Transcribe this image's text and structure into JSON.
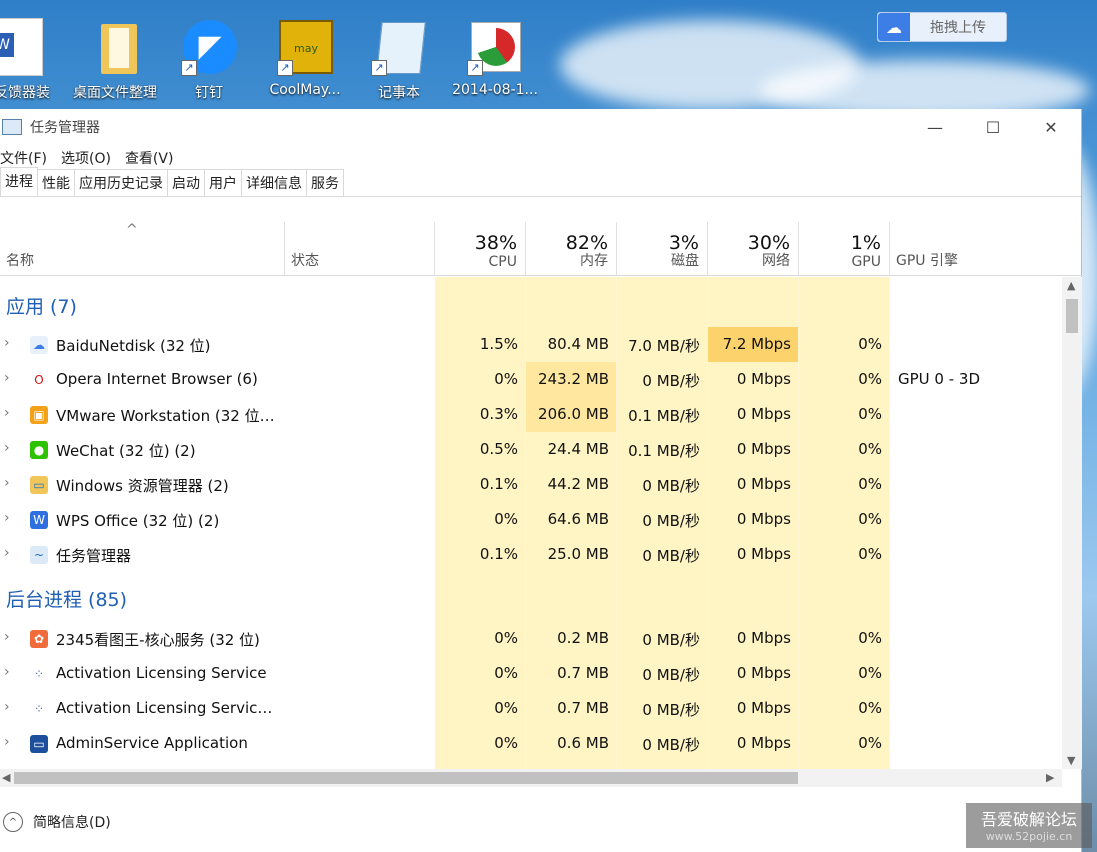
{
  "desktop": {
    "icons": [
      {
        "label": "边反馈器装",
        "icon": "word-doc-icon"
      },
      {
        "label": "桌面文件整理",
        "icon": "folder-icon"
      },
      {
        "label": "钉钉",
        "icon": "dingtalk-icon"
      },
      {
        "label": "CoolMay...",
        "icon": "coolmay-icon"
      },
      {
        "label": "记事本",
        "icon": "notepad-icon"
      },
      {
        "label": "2014-08-1...",
        "icon": "chart-file-icon"
      }
    ],
    "upload_button": "拖拽上传",
    "watermark": {
      "title": "吾爱破解论坛",
      "url": "www.52pojie.cn"
    }
  },
  "window": {
    "title": "任务管理器",
    "controls": {
      "minimize": "—",
      "maximize": "☐",
      "close": "✕"
    },
    "menu": [
      "文件(F)",
      "选项(O)",
      "查看(V)"
    ],
    "tabs": [
      "进程",
      "性能",
      "应用历史记录",
      "启动",
      "用户",
      "详细信息",
      "服务"
    ],
    "active_tab": "进程",
    "columns": {
      "name": "名称",
      "status": "状态",
      "cpu": {
        "pct": "38%",
        "label": "CPU"
      },
      "memory": {
        "pct": "82%",
        "label": "内存"
      },
      "disk": {
        "pct": "3%",
        "label": "磁盘"
      },
      "network": {
        "pct": "30%",
        "label": "网络"
      },
      "gpu": {
        "pct": "1%",
        "label": "GPU"
      },
      "gpu_engine": "GPU 引擎"
    },
    "sections": {
      "apps": "应用 (7)",
      "background": "后台进程 (85)"
    },
    "apps": [
      {
        "name": "BaiduNetdisk (32 位)",
        "cpu": "1.5%",
        "mem": "80.4 MB",
        "disk": "7.0 MB/秒",
        "net": "7.2 Mbps",
        "gpu": "0%",
        "gpu_engine": "",
        "icon": "baidunetdisk-icon"
      },
      {
        "name": "Opera Internet Browser (6)",
        "cpu": "0%",
        "mem": "243.2 MB",
        "disk": "0 MB/秒",
        "net": "0 Mbps",
        "gpu": "0%",
        "gpu_engine": "GPU 0 - 3D",
        "icon": "opera-icon"
      },
      {
        "name": "VMware Workstation (32 位) ...",
        "cpu": "0.3%",
        "mem": "206.0 MB",
        "disk": "0.1 MB/秒",
        "net": "0 Mbps",
        "gpu": "0%",
        "gpu_engine": "",
        "icon": "vmware-icon"
      },
      {
        "name": "WeChat (32 位) (2)",
        "cpu": "0.5%",
        "mem": "24.4 MB",
        "disk": "0.1 MB/秒",
        "net": "0 Mbps",
        "gpu": "0%",
        "gpu_engine": "",
        "icon": "wechat-icon"
      },
      {
        "name": "Windows 资源管理器 (2)",
        "cpu": "0.1%",
        "mem": "44.2 MB",
        "disk": "0 MB/秒",
        "net": "0 Mbps",
        "gpu": "0%",
        "gpu_engine": "",
        "icon": "explorer-icon"
      },
      {
        "name": "WPS Office (32 位) (2)",
        "cpu": "0%",
        "mem": "64.6 MB",
        "disk": "0 MB/秒",
        "net": "0 Mbps",
        "gpu": "0%",
        "gpu_engine": "",
        "icon": "wps-icon"
      },
      {
        "name": "任务管理器",
        "cpu": "0.1%",
        "mem": "25.0 MB",
        "disk": "0 MB/秒",
        "net": "0 Mbps",
        "gpu": "0%",
        "gpu_engine": "",
        "icon": "task-manager-icon"
      }
    ],
    "background": [
      {
        "name": "2345看图王-核心服务 (32 位)",
        "cpu": "0%",
        "mem": "0.2 MB",
        "disk": "0 MB/秒",
        "net": "0 Mbps",
        "gpu": "0%",
        "gpu_engine": "",
        "icon": "2345-viewer-icon"
      },
      {
        "name": "Activation Licensing Service",
        "cpu": "0%",
        "mem": "0.7 MB",
        "disk": "0 MB/秒",
        "net": "0 Mbps",
        "gpu": "0%",
        "gpu_engine": "",
        "icon": "service-icon"
      },
      {
        "name": "Activation Licensing Service ...",
        "cpu": "0%",
        "mem": "0.7 MB",
        "disk": "0 MB/秒",
        "net": "0 Mbps",
        "gpu": "0%",
        "gpu_engine": "",
        "icon": "service-icon"
      },
      {
        "name": "AdminService Application",
        "cpu": "0%",
        "mem": "0.6 MB",
        "disk": "0 MB/秒",
        "net": "0 Mbps",
        "gpu": "0%",
        "gpu_engine": "",
        "icon": "app-window-icon"
      }
    ],
    "footer": {
      "label": "简略信息(D)"
    },
    "colors": {
      "heat_light": "#fff4c4",
      "heat_mid": "#ffe7a0",
      "heat_high": "#fcd26c",
      "accent": "#1f5fb4"
    }
  }
}
